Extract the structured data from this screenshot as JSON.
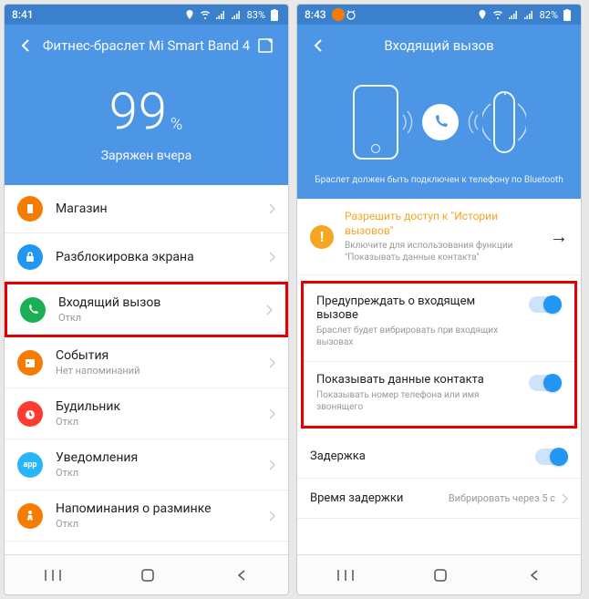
{
  "left": {
    "statusbar": {
      "time": "8:41",
      "battery": "83%"
    },
    "header": {
      "title": "Фитнес-браслет Mi Smart Band 4"
    },
    "hero": {
      "value": "99",
      "unit": "%",
      "subtitle": "Заряжен вчера"
    },
    "rows": [
      {
        "icon_bg": "#f57c00",
        "label": "Магазин",
        "sub": ""
      },
      {
        "icon_bg": "#2196f3",
        "label": "Разблокировка экрана",
        "sub": ""
      },
      {
        "icon_bg": "#1aaf54",
        "label": "Входящий вызов",
        "sub": "Откл"
      },
      {
        "icon_bg": "#f57c00",
        "label": "События",
        "sub": "Нет напоминаний"
      },
      {
        "icon_bg": "#ff3b30",
        "label": "Будильник",
        "sub": "Откл"
      },
      {
        "icon_bg": "#29b6f6",
        "label": "Уведомления",
        "sub": "Откл"
      },
      {
        "icon_bg": "#f57c00",
        "label": "Напоминания о разминке",
        "sub": "Откл"
      }
    ]
  },
  "right": {
    "statusbar": {
      "time": "8:43",
      "battery": "82%"
    },
    "header": {
      "title": "Входящий вызов"
    },
    "hero_footer": "Браслет должен быть подключен к телефону по Bluetooth",
    "permission": {
      "title": "Разрешить доступ к \"Истории вызовов\"",
      "desc": "Включите для использования функции \"Показывать данные контакта\""
    },
    "settings": [
      {
        "title": "Предупреждать о входящем вызове",
        "desc": "Браслет будет вибрировать при входящих вызовах"
      },
      {
        "title": "Показывать данные контакта",
        "desc": "Показывать номер телефона или имя звонящего"
      }
    ],
    "delay": {
      "label": "Задержка"
    },
    "delay_time": {
      "label": "Время задержки",
      "value": "Вибрировать через 5 с"
    }
  }
}
